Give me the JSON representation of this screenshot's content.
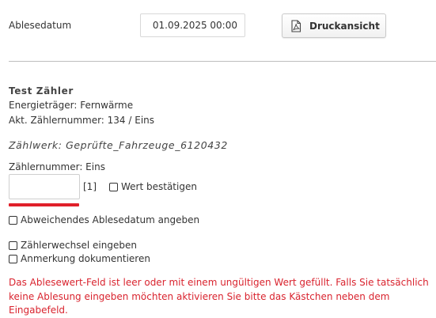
{
  "reading_date": {
    "label": "Ablesedatum",
    "value": "01.09.2025 00:00"
  },
  "print_button": {
    "label": "Druckansicht",
    "icon": "pdf-icon"
  },
  "meter": {
    "title": "Test Zähler",
    "energy_carrier": "Energieträger: Fernwärme",
    "current_number": "Akt. Zählernummer: 134 / Eins",
    "register": "Zählwerk: Geprüfte_Fahrzeuge_6120432",
    "meter_number_label": "Zählernummer: Eins",
    "value_input": "",
    "index_tag": "[1]",
    "confirm_label": "Wert bestätigen"
  },
  "options": {
    "different_date": "Abweichendes Ablesedatum angeben",
    "meter_change": "Zählerwechsel eingeben",
    "document_note": "Anmerkung dokumentieren"
  },
  "error": {
    "line1": "Das Ablesewert-Feld ist leer oder mit einem ungültigen Wert gefüllt. Falls Sie tatsächlich",
    "line2": "keine Ablesung eingeben möchten aktivieren Sie bitte das Kästchen neben dem Eingabefeld.",
    "color": "#d9232e"
  }
}
